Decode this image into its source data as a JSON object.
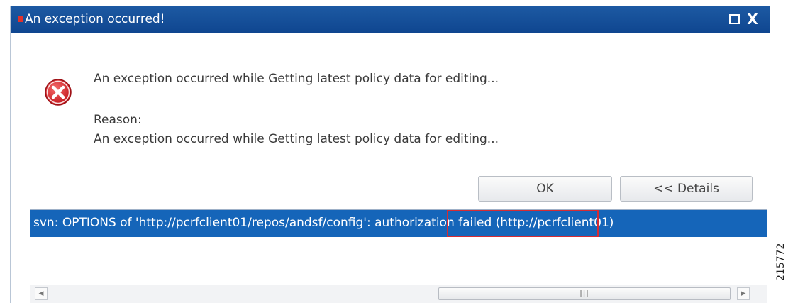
{
  "dialog": {
    "title": "An exception occurred!",
    "icons": {
      "title_mark": "red-square-icon",
      "maximize": "maximize-icon",
      "close": "close-icon",
      "error": "error-x-icon"
    },
    "close_glyph": "X",
    "message": "An exception occurred while Getting latest policy data for editing...",
    "reason_label": "Reason:",
    "reason_text": "An exception occurred while Getting latest policy data for editing...",
    "buttons": {
      "ok": "OK",
      "details": "<< Details"
    },
    "details": {
      "text": "svn: OPTIONS of 'http://pcrfclient01/repos/andsf/config': authorization failed (http://pcrfclient01)",
      "highlighted": "authorization failed"
    },
    "scrollbar": {
      "left_arrow": "◀",
      "right_arrow": "▶",
      "grip": "III"
    }
  },
  "figure_id": "215772",
  "colors": {
    "titlebar": "#1d5aa3",
    "selection": "#1565b9",
    "highlight_border": "#d62b33",
    "error_icon": "#d9252b"
  }
}
